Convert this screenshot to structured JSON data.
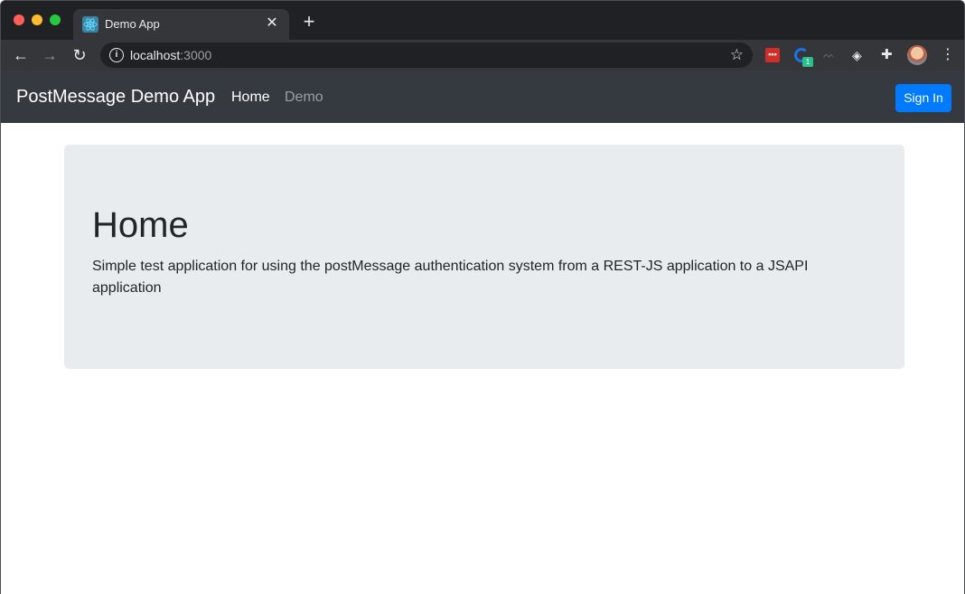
{
  "browser": {
    "tab_title": "Demo App",
    "tab_close": "✕",
    "new_tab": "+",
    "url_host": "localhost",
    "url_port": ":3000",
    "icons": {
      "back": "back-arrow-icon",
      "forward": "forward-arrow-icon",
      "reload": "reload-icon",
      "info": "info-icon",
      "bookmark": "star-icon",
      "extensions": "puzzle-icon",
      "menu": "kebab-menu-icon"
    },
    "extension_badge": "1"
  },
  "navbar": {
    "brand": "PostMessage Demo App",
    "links": [
      "Home",
      "Demo"
    ],
    "signin_label": "Sign In",
    "bg_color": "#343a40",
    "button_color": "#007bff"
  },
  "main": {
    "title": "Home",
    "description": "Simple test application for using the postMessage authentication system from a REST-JS application to a JSAPI application"
  }
}
